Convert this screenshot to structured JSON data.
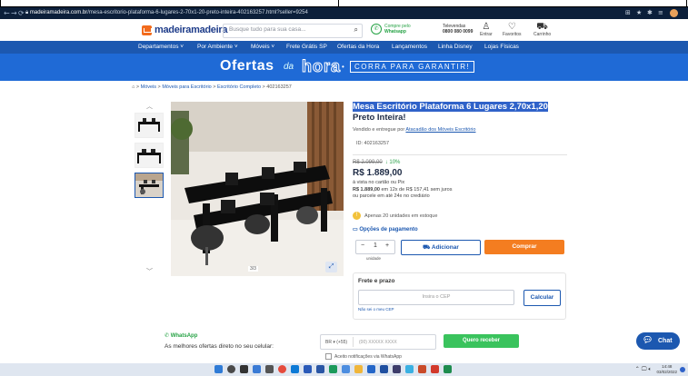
{
  "browser": {
    "url_host": "madeiramadeira.com.br",
    "url_path": "/mesa-escritorio-plataforma-6-lugares-2-70x1-20-preto-inteira-402163257.html?seller=9254"
  },
  "header": {
    "logo": "madeiramadeira",
    "search_placeholder": "Busque tudo para sua casa...",
    "whatsapp_line1": "Compre pelo",
    "whatsapp_line2": "Whatsapp",
    "televendas_line1": "Televendas",
    "televendas_line2": "0800 080 0099",
    "entrar": "Entrar",
    "favoritos": "Favoritos",
    "carrinho": "Carrinho"
  },
  "menu": {
    "items": [
      "Departamentos ˅",
      "Por Ambiente ˅",
      "Móveis ˅",
      "Frete Grátis SP",
      "Ofertas da Hora",
      "Lançamentos",
      "Linha Disney",
      "Lojas Físicas"
    ]
  },
  "banner": {
    "ofertas": "Ofertas",
    "da": "da",
    "hora": "hora",
    "dot": "•",
    "corra": "CORRA PARA GARANTIR!"
  },
  "breadcrumb": {
    "home": "⌂",
    "items": [
      "Móveis",
      "Móveis para Escritório",
      "Escritório Completo",
      "402163257"
    ]
  },
  "gallery": {
    "pager": "3/3"
  },
  "product": {
    "title_highlight": "Mesa Escritório Plataforma 6 Lugares 2,70x1,20",
    "title_rest": "Preto Inteira!",
    "seller_prefix": "Vendido e entregue por",
    "seller_name": "Atacadão dos Móveis Escritório",
    "id": "ID: 402163257",
    "old_price": "R$ 2.099,00",
    "discount": "↓ 10%",
    "price": "R$ 1.889,00",
    "price_info_1": "à vista no cartão ou Pix",
    "price_info_2_bold": "R$ 1.889,00",
    "price_info_2_rest": " em 12x de R$ 157,41 sem juros",
    "price_info_3": "ou parcele em até 24x no crediário",
    "stock": "Apenas 20 unidades em estoque",
    "payment_options": "Opções de pagamento",
    "qty_minus": "−",
    "qty_value": "1",
    "qty_plus": "+",
    "qty_unit": "unidade",
    "add_label": "Adicionar",
    "buy_label": "Comprar"
  },
  "shipping": {
    "title": "Frete e prazo",
    "cep_placeholder": "Insira o CEP",
    "calc_label": "Calcular",
    "no_cep": "Não sei o meu CEP"
  },
  "footer": {
    "whatsapp_title": "WhatsApp",
    "whatsapp_sub": "As melhores ofertas direto no seu celular:",
    "country": "BR ▾ (+55)",
    "phone_placeholder": "(00) XXXXX XXXX",
    "receive_label": "Quero receber",
    "notif_label": "Aceito notificações via WhatsApp",
    "chat_label": "Chat"
  },
  "taskbar": {
    "time": "14:48",
    "date": "03/02/2022"
  },
  "colors": {
    "brand_blue": "#1c58b0",
    "banner_blue": "#1f6ad6",
    "orange": "#f47d20",
    "green": "#3ac35d"
  }
}
